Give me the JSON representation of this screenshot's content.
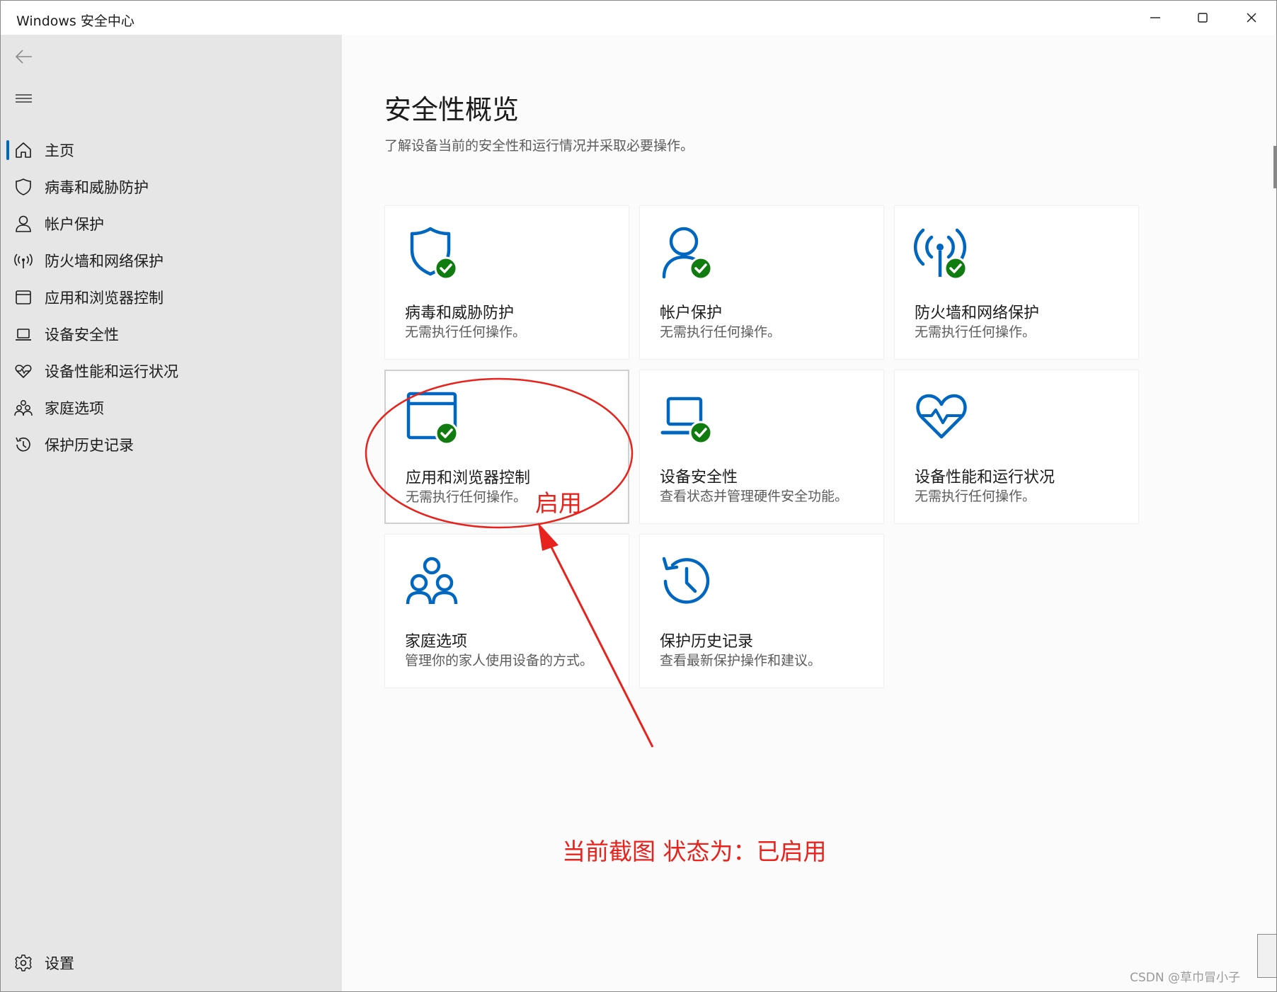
{
  "window": {
    "title": "Windows 安全中心"
  },
  "sidebar": {
    "items": [
      {
        "label": "主页",
        "icon": "home-icon"
      },
      {
        "label": "病毒和威胁防护",
        "icon": "shield-icon"
      },
      {
        "label": "帐户保护",
        "icon": "person-icon"
      },
      {
        "label": "防火墙和网络保护",
        "icon": "antenna-icon"
      },
      {
        "label": "应用和浏览器控制",
        "icon": "browser-window-icon"
      },
      {
        "label": "设备安全性",
        "icon": "laptop-icon"
      },
      {
        "label": "设备性能和运行状况",
        "icon": "heart-pulse-icon"
      },
      {
        "label": "家庭选项",
        "icon": "family-icon"
      },
      {
        "label": "保护历史记录",
        "icon": "history-icon"
      }
    ],
    "active_index": 0,
    "settings_label": "设置"
  },
  "main": {
    "title": "安全性概览",
    "subtitle": "了解设备当前的安全性和运行情况并采取必要操作。",
    "tiles": [
      {
        "name": "病毒和威胁防护",
        "desc": "无需执行任何操作。",
        "icon": "shield-icon",
        "status": "ok"
      },
      {
        "name": "帐户保护",
        "desc": "无需执行任何操作。",
        "icon": "person-icon",
        "status": "ok"
      },
      {
        "name": "防火墙和网络保护",
        "desc": "无需执行任何操作。",
        "icon": "antenna-icon",
        "status": "ok"
      },
      {
        "name": "应用和浏览器控制",
        "desc": "无需执行任何操作。",
        "icon": "browser-window-icon",
        "status": "ok"
      },
      {
        "name": "设备安全性",
        "desc": "查看状态并管理硬件安全功能。",
        "icon": "laptop-icon",
        "status": "ok"
      },
      {
        "name": "设备性能和运行状况",
        "desc": "无需执行任何操作。",
        "icon": "heart-pulse-icon",
        "status": "none"
      },
      {
        "name": "家庭选项",
        "desc": "管理你的家人使用设备的方式。",
        "icon": "family-icon",
        "status": "none"
      },
      {
        "name": "保护历史记录",
        "desc": "查看最新保护操作和建议。",
        "icon": "history-icon",
        "status": "none"
      }
    ]
  },
  "annotation": {
    "circle_label": "启用",
    "caption": "当前截图 状态为：已启用",
    "color": "#e8221c"
  },
  "watermark": "CSDN @草巾冒小子",
  "colors": {
    "accent": "#0067c0",
    "ok": "#107c10",
    "sidebar_bg": "#e6e6e6"
  }
}
